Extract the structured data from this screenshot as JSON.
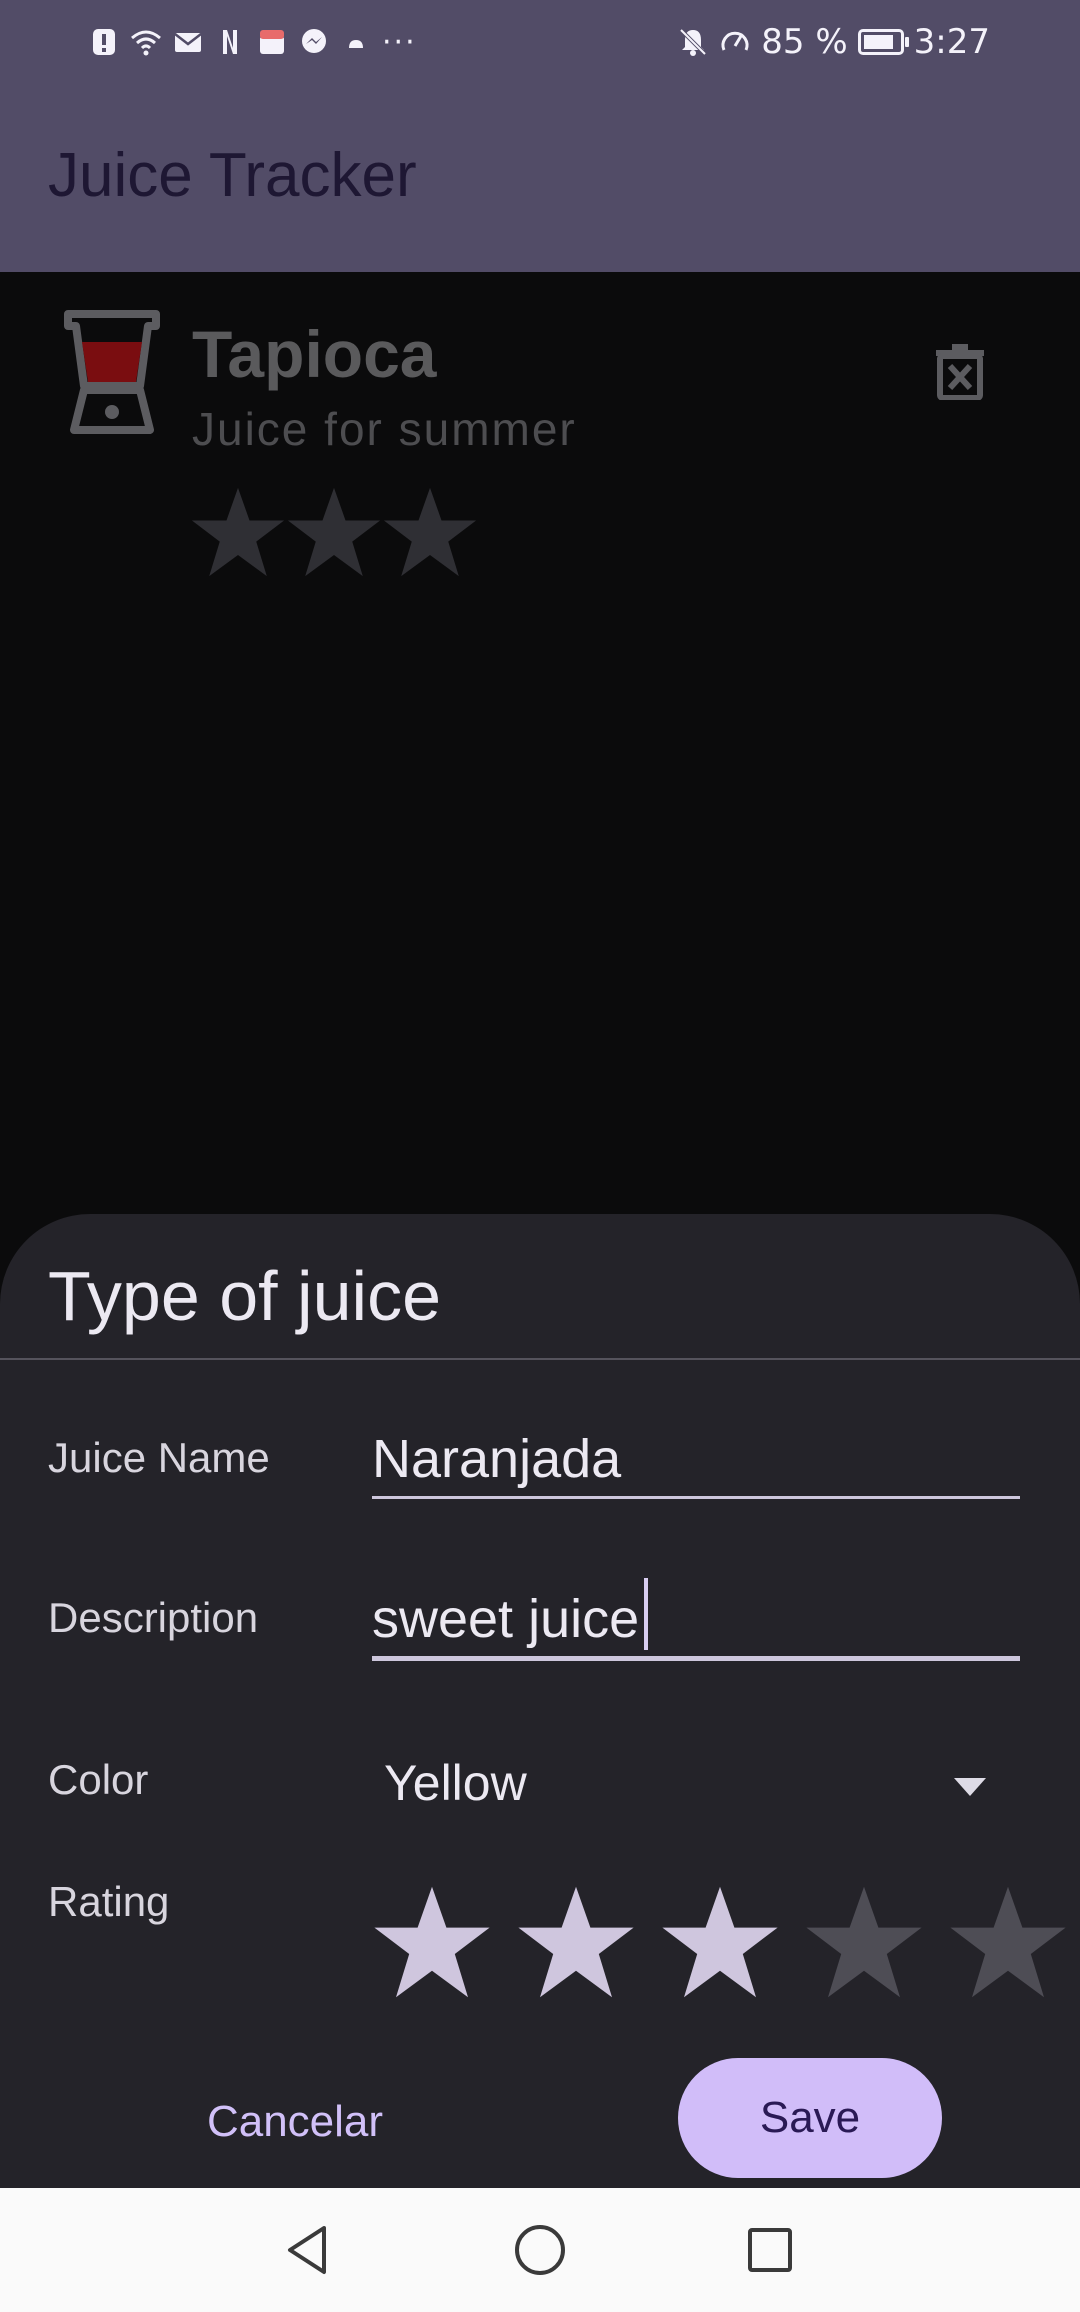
{
  "status_bar": {
    "battery": "85 %",
    "time": "3:27",
    "battery_level": 0.85,
    "more_icons": "···"
  },
  "app_bar": {
    "title": "Juice Tracker"
  },
  "juice_list": [
    {
      "name": "Tapioca",
      "description": "Juice for summer",
      "rating": 3,
      "color": "#7a0d10"
    }
  ],
  "sheet": {
    "title": "Type of juice",
    "name_label": "Juice Name",
    "name_value": "Naranjada",
    "description_label": "Description",
    "description_value": "sweet juice",
    "color_label": "Color",
    "color_value": "Yellow",
    "rating_label": "Rating",
    "rating_value": 3,
    "rating_max": 5,
    "cancel_label": "Cancelar",
    "save_label": "Save"
  },
  "colors": {
    "app_bar": "#524c67",
    "sheet_bg": "#242329",
    "accent": "#d1bdf9",
    "star_filled": "#cfc6de",
    "star_empty": "#4e4d55",
    "list_star": "#2f2f34"
  }
}
